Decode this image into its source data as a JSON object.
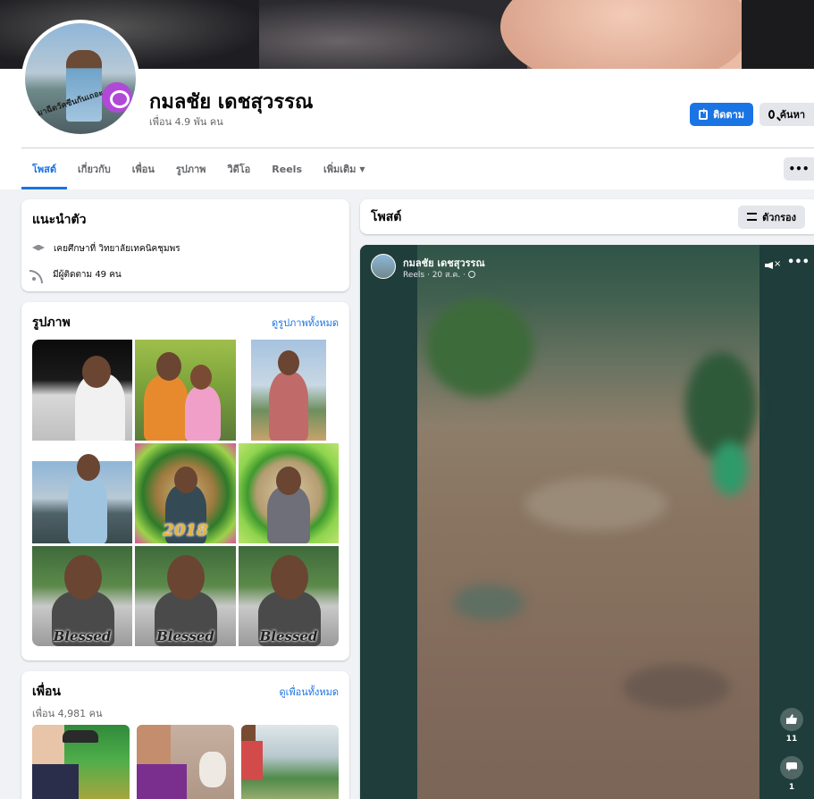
{
  "profile": {
    "avatar_frame_text": "มาฉีดวัคซีนกันเถอะ",
    "name": "กมลชัย เดชสุวรรณ",
    "followers": "เพื่อน 4.9 พัน คน"
  },
  "actions": {
    "follow_label": "ติดตาม",
    "search_label": "ค้นหา",
    "more_label": "•••"
  },
  "tabs": [
    {
      "label": "โพสต์"
    },
    {
      "label": "เกี่ยวกับ"
    },
    {
      "label": "เพื่อน"
    },
    {
      "label": "รูปภาพ"
    },
    {
      "label": "วิดีโอ"
    },
    {
      "label": "Reels"
    },
    {
      "label": "เพิ่มเติม"
    }
  ],
  "intro": {
    "title": "แนะนำตัว",
    "education": "เคยศึกษาที่ วิทยาลัยเทคนิคชุมพร",
    "followed_by": "มีผู้ติดตาม 49 คน"
  },
  "photos": {
    "title": "รูปภาพ",
    "see_all": "ดูรูปภาพทั้งหมด",
    "captions": [
      "",
      "",
      "",
      "",
      "2018",
      "",
      "Blessed",
      "Blessed",
      "Blessed"
    ]
  },
  "friends": {
    "title": "เพื่อน",
    "count": "เพื่อน 4,981 คน",
    "see_all": "ดูเพื่อนทั้งหมด"
  },
  "posts": {
    "title": "โพสต์",
    "filter_label": "ตัวกรอง"
  },
  "reel": {
    "author": "กมลชัย เดชสุวรรณ",
    "meta": "Reels · 20 ส.ค. ·",
    "more_label": "•••",
    "likes": "11",
    "comments": "1"
  },
  "colors": {
    "accent": "#1b74e4",
    "background": "#f0f2f5",
    "secondary_text": "#65676b"
  }
}
